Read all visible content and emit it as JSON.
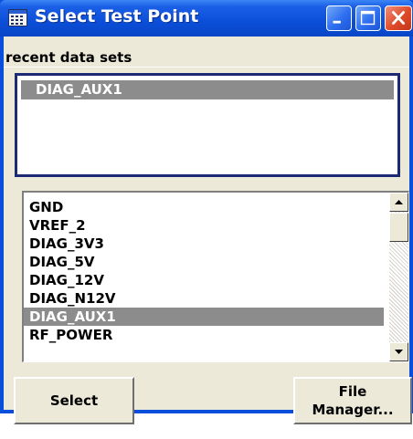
{
  "window": {
    "title": "Select Test Point",
    "buttons": [
      "minimize",
      "maximize",
      "close"
    ]
  },
  "recent": {
    "label": "recent data sets",
    "items": [
      "DIAG_AUX1"
    ],
    "selected_index": 0
  },
  "test_points": {
    "items": [
      "GND",
      "VREF_2",
      "DIAG_3V3",
      "DIAG_5V",
      "DIAG_12V",
      "DIAG_N12V",
      "DIAG_AUX1",
      "RF_POWER"
    ],
    "selected_index": 6
  },
  "actions": {
    "select_label": "Select",
    "file_manager_line1": "File",
    "file_manager_line2": "Manager..."
  },
  "icons": {
    "app": "window-app-icon",
    "minimize": "minimize-icon",
    "maximize": "maximize-icon",
    "close": "close-icon",
    "scroll_up": "scroll-up-arrow-icon",
    "scroll_down": "scroll-down-arrow-icon"
  },
  "colors": {
    "title_bar": "#0b4ed8",
    "close_button": "#de4a28",
    "selection": "#8c8c8c",
    "recent_border": "#1d2a73",
    "dialog_bg": "#ece9d8"
  }
}
